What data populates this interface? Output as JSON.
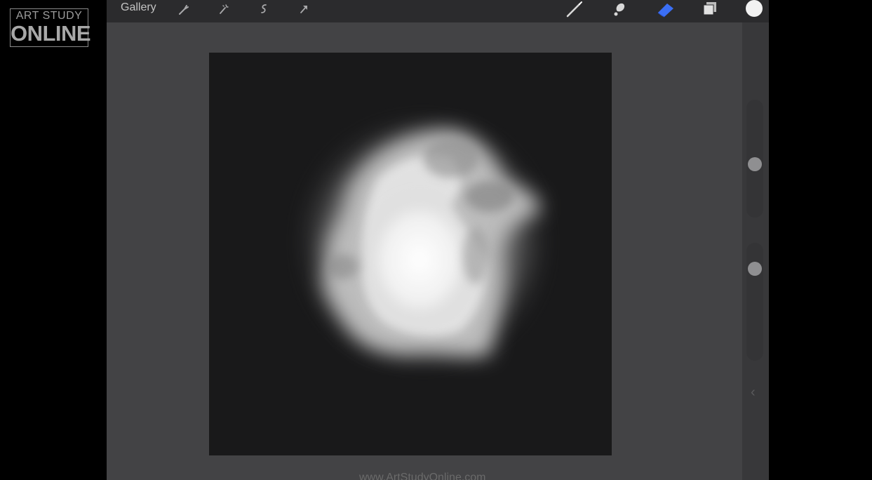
{
  "watermark": {
    "line1": "ART STUDY",
    "line2": "ONLINE"
  },
  "topbar": {
    "gallery_label": "Gallery",
    "left_tools": [
      "wrench-icon",
      "magic-wand-icon",
      "selection-icon",
      "transform-arrow-icon"
    ],
    "right_tools": [
      "brush-icon",
      "smudge-icon",
      "eraser-icon",
      "layers-icon",
      "color-swatch-icon"
    ],
    "active_tool": "eraser-icon",
    "active_color": "#3b6ff5",
    "current_color": "#f2f2f2"
  },
  "sidebar": {
    "brush_size_control": "size-slider",
    "opacity_control": "opacity-slider"
  },
  "canvas": {
    "background_color": "#19191a"
  },
  "footer": {
    "url_text": "www.ArtStudyOnline.com"
  }
}
